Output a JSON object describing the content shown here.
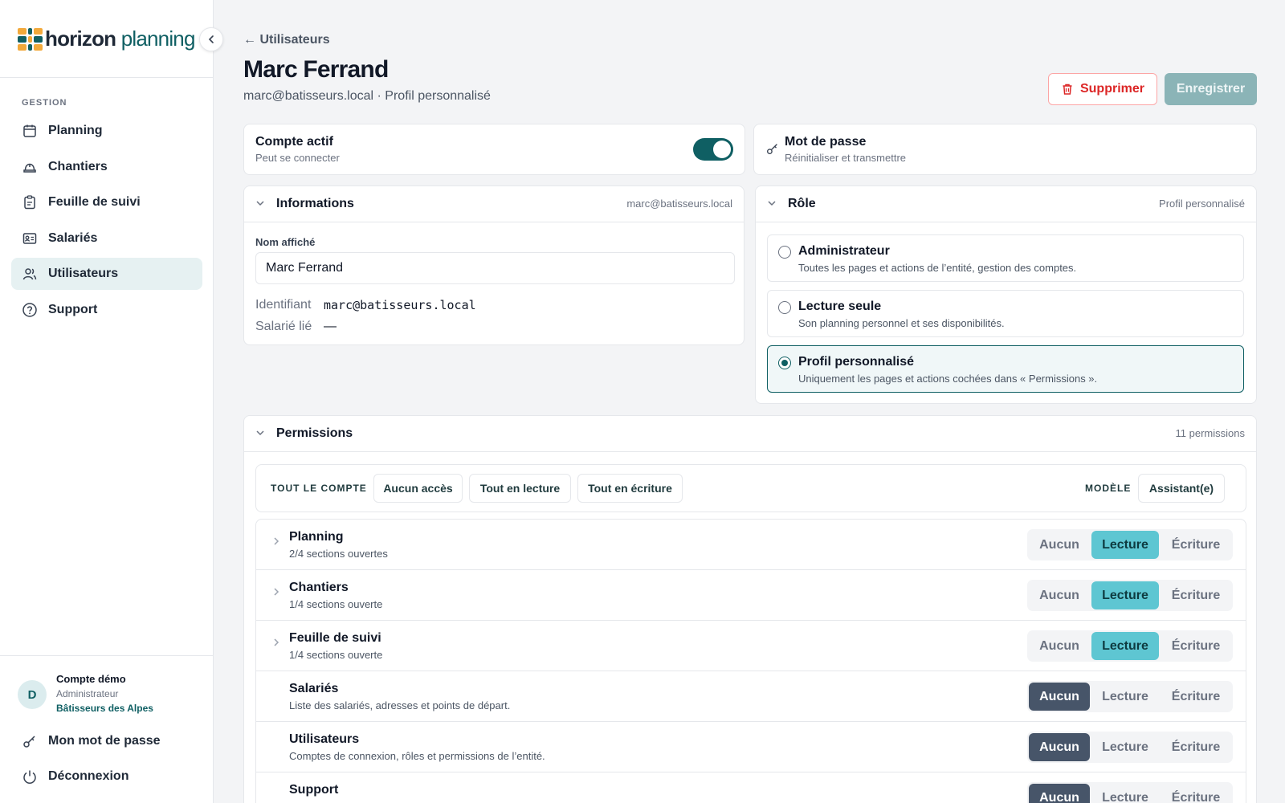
{
  "sidebar": {
    "logo_main": "horizon",
    "logo_accent": "planning",
    "section_label": "GESTION",
    "items": [
      {
        "label": "Planning",
        "icon": "calendar-icon",
        "active": false
      },
      {
        "label": "Chantiers",
        "icon": "hard-hat-icon",
        "active": false
      },
      {
        "label": "Feuille de suivi",
        "icon": "clipboard-icon",
        "active": false
      },
      {
        "label": "Salariés",
        "icon": "id-card-icon",
        "active": false
      },
      {
        "label": "Utilisateurs",
        "icon": "users-icon",
        "active": true
      },
      {
        "label": "Support",
        "icon": "help-circle-icon",
        "active": false
      }
    ],
    "user": {
      "initial": "D",
      "name": "Compte démo",
      "role": "Administrateur",
      "org": "Bâtisseurs des Alpes"
    },
    "my_password": "Mon mot de passe",
    "logout": "Déconnexion"
  },
  "header": {
    "back_label": "← Utilisateurs",
    "title": "Marc Ferrand",
    "subtitle": "marc@batisseurs.local · Profil personnalisé",
    "delete_label": "Supprimer",
    "save_label": "Enregistrer"
  },
  "account": {
    "title": "Compte actif",
    "sub": "Peut se connecter",
    "active": true
  },
  "password": {
    "title": "Mot de passe",
    "sub": "Réinitialiser et transmettre"
  },
  "info": {
    "title": "Informations",
    "right": "marc@batisseurs.local",
    "name_label": "Nom affiché",
    "name_value": "Marc Ferrand",
    "id_label": "Identifiant",
    "id_value": "marc@batisseurs.local",
    "employee_label": "Salarié lié",
    "employee_value": "—"
  },
  "role": {
    "title": "Rôle",
    "right": "Profil personnalisé",
    "options": [
      {
        "name": "Administrateur",
        "desc": "Toutes les pages et actions de l’entité, gestion des comptes.",
        "selected": false
      },
      {
        "name": "Lecture seule",
        "desc": "Son planning personnel et ses disponibilités.",
        "selected": false
      },
      {
        "name": "Profil personnalisé",
        "desc": "Uniquement les pages et actions cochées dans « Permissions ».",
        "selected": true
      }
    ]
  },
  "permissions": {
    "title": "Permissions",
    "right": "11 permissions",
    "bulk_label": "TOUT LE COMPTE",
    "bulk_none": "Aucun accès",
    "bulk_read": "Tout en lecture",
    "bulk_write": "Tout en écriture",
    "model_label": "MODÈLE",
    "model_value": "Assistant(e)",
    "level_labels": {
      "none": "Aucun",
      "read": "Lecture",
      "write": "Écriture"
    },
    "rows": [
      {
        "name": "Planning",
        "desc": "2/4 sections ouvertes",
        "level": "read",
        "expandable": true
      },
      {
        "name": "Chantiers",
        "desc": "1/4 sections ouverte",
        "level": "read",
        "expandable": true
      },
      {
        "name": "Feuille de suivi",
        "desc": "1/4 sections ouverte",
        "level": "read",
        "expandable": true
      },
      {
        "name": "Salariés",
        "desc": "Liste des salariés, adresses et points de départ.",
        "level": "none",
        "expandable": false
      },
      {
        "name": "Utilisateurs",
        "desc": "Comptes de connexion, rôles et permissions de l’entité.",
        "level": "none",
        "expandable": false
      },
      {
        "name": "Support",
        "desc": "",
        "level": "none",
        "expandable": false
      }
    ]
  },
  "colors": {
    "brand": "#0f5f63",
    "read_active": "#5ec6d2",
    "none_active": "#475569",
    "danger": "#dc2626"
  }
}
